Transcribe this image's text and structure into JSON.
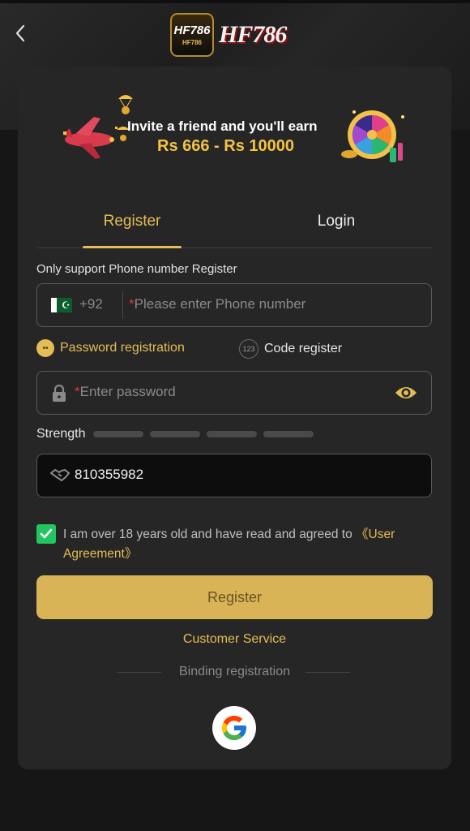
{
  "header": {
    "logo_badge": "HF786",
    "logo_badge_small": "HF786",
    "logo_text": "HF786"
  },
  "banner": {
    "line1": "Invite a friend and you'll earn",
    "line2": "Rs 666 - Rs 10000"
  },
  "tabs": [
    {
      "label": "Register",
      "active": true
    },
    {
      "label": "Login",
      "active": false
    }
  ],
  "form": {
    "hint": "Only support Phone number Register",
    "country_code": "+92",
    "phone_placeholder": "Please enter Phone number",
    "modes": {
      "password": "Password registration",
      "code": "Code register",
      "code_icon": "123",
      "active": "password"
    },
    "password_placeholder": "Enter password",
    "strength_label": "Strength",
    "strength_level": 0,
    "invite_code": "810355982",
    "agreement_text": "I am over 18 years old and have read and agreed to ",
    "agreement_link": "《User Agreement》",
    "agreement_checked": true,
    "register_button": "Register",
    "customer_service": "Customer Service",
    "binding_label": "Binding registration"
  },
  "colors": {
    "accent": "#e4bd57",
    "button": "#d8b457",
    "check": "#22c55e",
    "card": "#262626",
    "background": "#161616"
  },
  "icons": [
    "back-arrow-icon",
    "pakistan-flag-icon",
    "lock-icon",
    "eye-icon",
    "handshake-icon",
    "checkmark-icon",
    "google-icon"
  ]
}
